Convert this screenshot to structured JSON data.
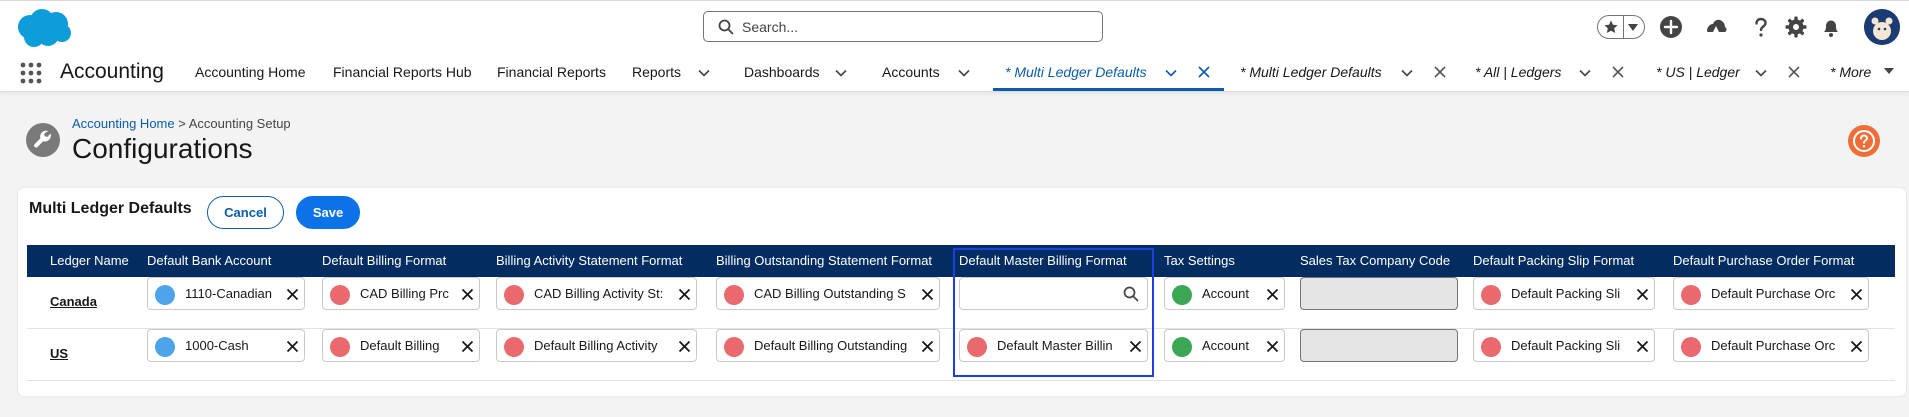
{
  "search": {
    "placeholder": "Search..."
  },
  "app": {
    "name": "Accounting"
  },
  "nav": {
    "items": [
      {
        "label": "Accounting Home"
      },
      {
        "label": "Financial Reports Hub"
      },
      {
        "label": "Financial Reports"
      },
      {
        "label": "Reports"
      },
      {
        "label": "Dashboards"
      },
      {
        "label": "Accounts"
      },
      {
        "label": "* Multi Ledger Defaults"
      },
      {
        "label": "* Multi Ledger Defaults"
      },
      {
        "label": "* All | Ledgers"
      },
      {
        "label": "* US | Ledger"
      },
      {
        "label": "* More"
      }
    ]
  },
  "page": {
    "breadcrumb_link": "Accounting Home",
    "breadcrumb_sep": ">",
    "breadcrumb_current": "Accounting Setup",
    "title": "Configurations"
  },
  "card": {
    "title": "Multi Ledger Defaults",
    "cancel_label": "Cancel",
    "save_label": "Save"
  },
  "table": {
    "headers": [
      "Ledger Name",
      "Default Bank Account",
      "Default Billing Format",
      "Billing Activity Statement Format",
      "Billing Outstanding Statement Format",
      "Default Master Billing Format",
      "Tax Settings",
      "Sales Tax Company Code",
      "Default Packing Slip Format",
      "Default Purchase Order Format"
    ],
    "rows": [
      {
        "ledger": "Canada",
        "bank_account": "1110-Canadian",
        "billing_format": "CAD Billing Prc",
        "activity_statement": "CAD Billing Activity St:",
        "outstanding_statement": "CAD Billing Outstanding S",
        "master_billing": "",
        "tax_settings": "Account",
        "sales_tax_code": "",
        "packing_slip": "Default Packing Sli",
        "purchase_order": "Default Purchase Orc"
      },
      {
        "ledger": "US",
        "bank_account": "1000-Cash",
        "billing_format": "Default Billing",
        "activity_statement": "Default Billing Activity",
        "outstanding_statement": "Default Billing Outstanding",
        "master_billing": "Default Master Billin",
        "tax_settings": "Account",
        "sales_tax_code": "",
        "packing_slip": "Default Packing Sli",
        "purchase_order": "Default Purchase Orc"
      }
    ]
  },
  "colors": {
    "brand_blue": "#0b5cab",
    "header_navy": "#032d60",
    "highlight": "#1e3ee0",
    "help_orange": "#ef6e37"
  }
}
